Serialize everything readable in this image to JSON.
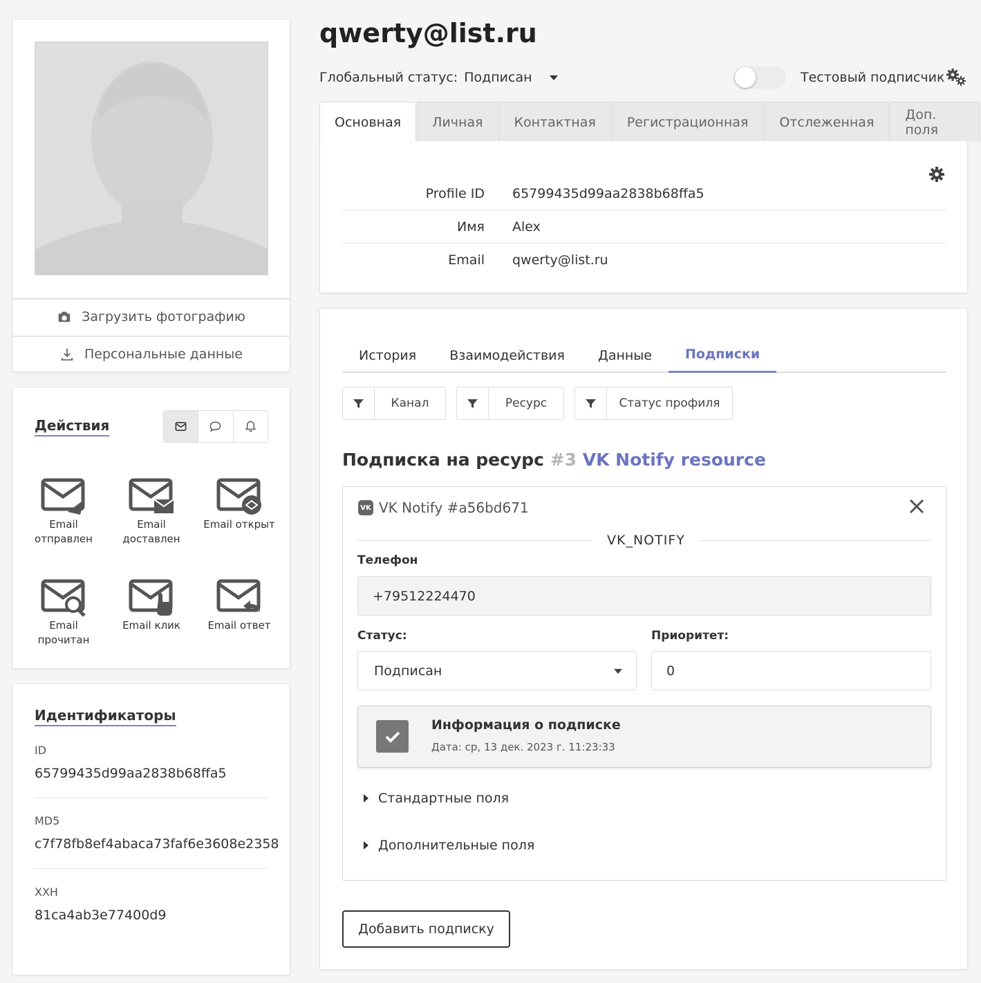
{
  "left": {
    "upload_photo": "Загрузить фотографию",
    "personal_data": "Персональные данные",
    "actions": {
      "title": "Действия",
      "items": [
        {
          "label": "Email отправлен",
          "icon": "email-sent-icon"
        },
        {
          "label": "Email доставлен",
          "icon": "email-delivered-icon"
        },
        {
          "label": "Email открыт",
          "icon": "email-opened-icon"
        },
        {
          "label": "Email прочитан",
          "icon": "email-read-icon"
        },
        {
          "label": "Email клик",
          "icon": "email-click-icon"
        },
        {
          "label": "Email ответ",
          "icon": "email-reply-icon"
        }
      ]
    },
    "identifiers": {
      "title": "Идентификаторы",
      "items": [
        {
          "label": "ID",
          "value": "65799435d99aa2838b68ffa5"
        },
        {
          "label": "MD5",
          "value": "c7f78fb8ef4abaca73faf6e3608e2358"
        },
        {
          "label": "XXH",
          "value": "81ca4ab3e77400d9"
        }
      ]
    }
  },
  "header": {
    "title": "qwerty@list.ru",
    "global_status_label": "Глобальный статус:",
    "global_status_value": "Подписан",
    "test_subscriber_label": "Тестовый подписчик",
    "test_subscriber_on": false
  },
  "tabs": [
    "Основная",
    "Личная",
    "Контактная",
    "Регистрационная",
    "Отслеженная",
    "Доп. поля"
  ],
  "main_info": [
    {
      "key": "Profile ID",
      "value": "65799435d99aa2838b68ffa5"
    },
    {
      "key": "Имя",
      "value": "Alex"
    },
    {
      "key": "Email",
      "value": "qwerty@list.ru"
    }
  ],
  "subtabs": [
    "История",
    "Взаимодействия",
    "Данные",
    "Подписки"
  ],
  "filters": [
    "Канал",
    "Ресурс",
    "Статус профиля"
  ],
  "subscription": {
    "heading": "Подписка на ресурс",
    "resource_num": "#3",
    "resource_name": "VK Notify resource",
    "card_title": "VK Notify #a56bd671",
    "vk_logo_text": "VK",
    "channel": "VK_NOTIFY",
    "phone_label": "Телефон",
    "phone_value": "+79512224470",
    "status_label": "Статус:",
    "status_value": "Подписан",
    "priority_label": "Приоритет:",
    "priority_value": "0",
    "info_title": "Информация о подписке",
    "info_date": "Дата: ср, 13 дек. 2023 г. 11:23:33",
    "standard_fields": "Стандартные поля",
    "extra_fields": "Дополнительные поля",
    "add_button": "Добавить подписку"
  },
  "colors": {
    "accent": "#7a82c8",
    "link": "#6b74c1"
  }
}
